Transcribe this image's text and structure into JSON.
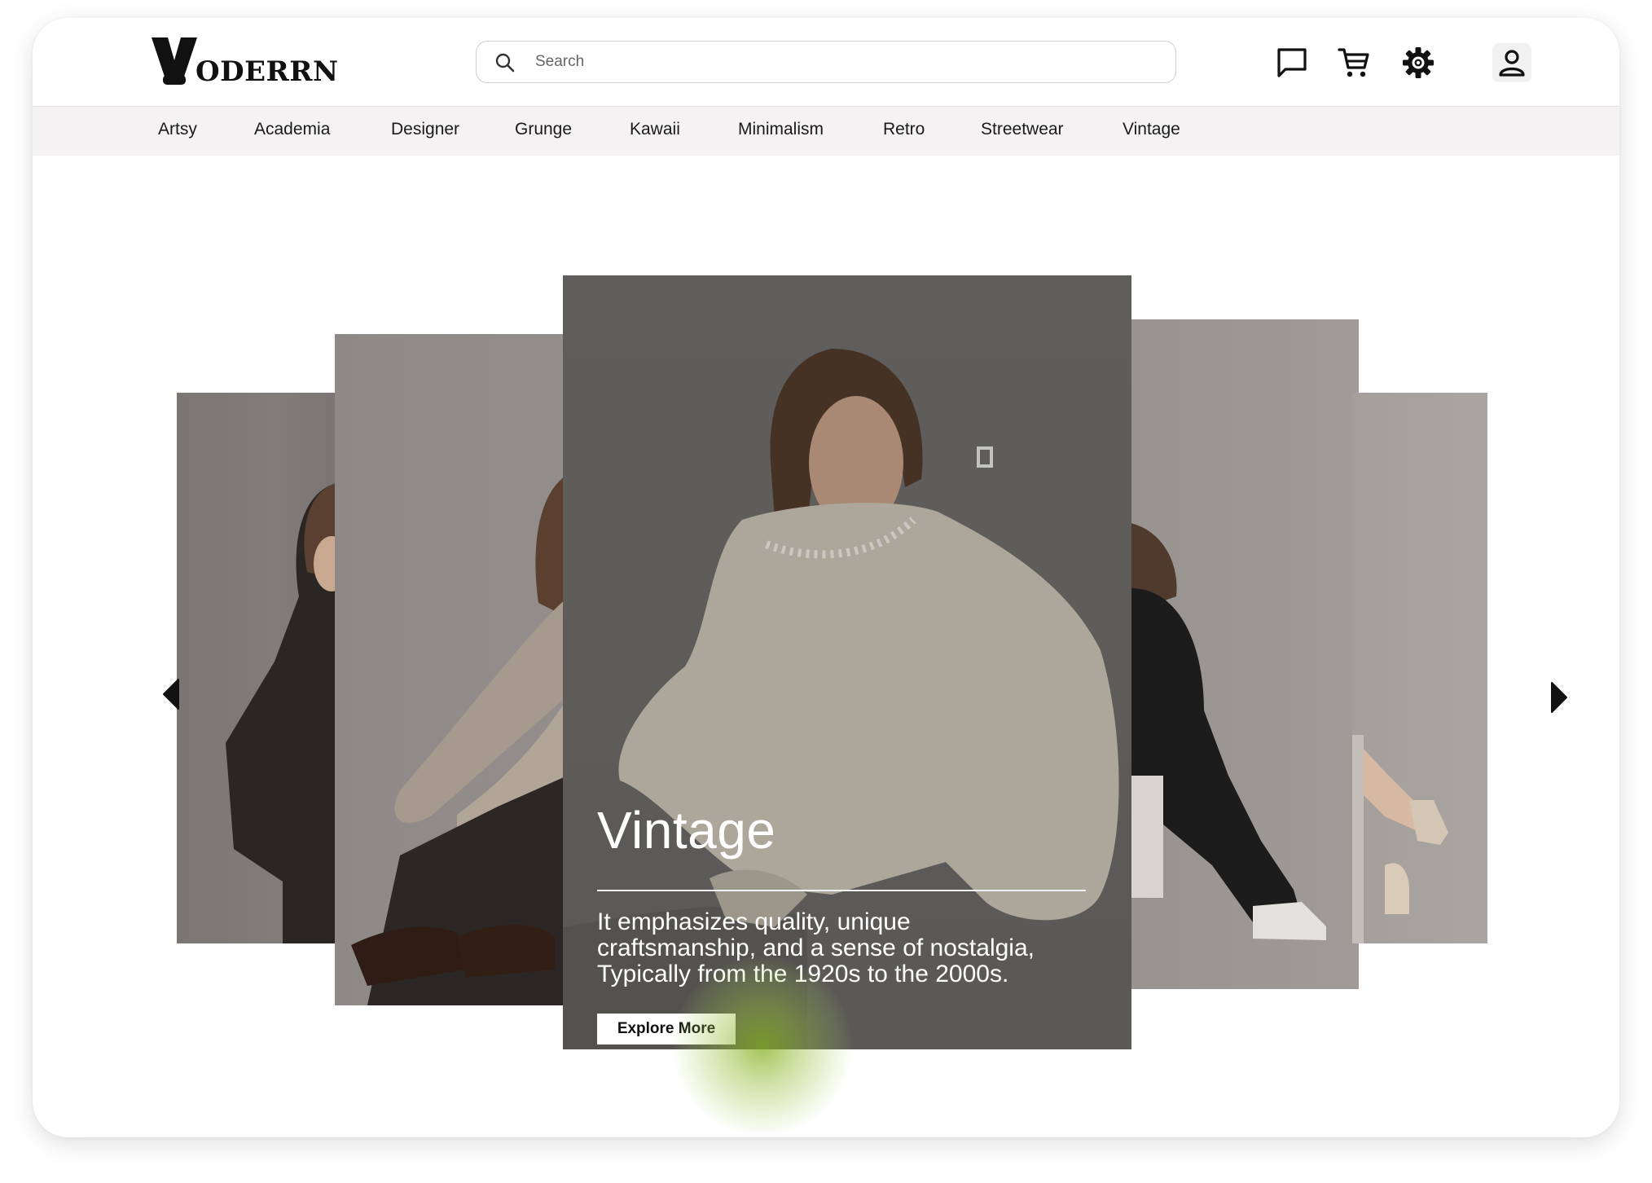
{
  "brand": {
    "logo_letter": "V",
    "logo_text": "ODERRN"
  },
  "search": {
    "placeholder": "Search",
    "value": ""
  },
  "header_icons": [
    "chat-icon",
    "cart-icon",
    "gear-icon",
    "user-icon"
  ],
  "nav": {
    "items": [
      "Artsy",
      "Academia",
      "Designer",
      "Grunge",
      "Kawaii",
      "Minimalism",
      "Retro",
      "Streetwear",
      "Vintage"
    ]
  },
  "carousel": {
    "active": {
      "title": "Vintage",
      "description_lines": [
        "It emphasizes quality, unique",
        "craftsmanship, and a sense of nostalgia,",
        "Typically from the 1920s to the 2000s."
      ],
      "cta_label": "Explore More"
    },
    "prev_icon": "arrow-left-icon",
    "next_icon": "arrow-right-icon"
  },
  "colors": {
    "nav_bg": "#f4f2f2",
    "overlay_text": "#ffffff",
    "cursor_highlight": "#84b022"
  }
}
